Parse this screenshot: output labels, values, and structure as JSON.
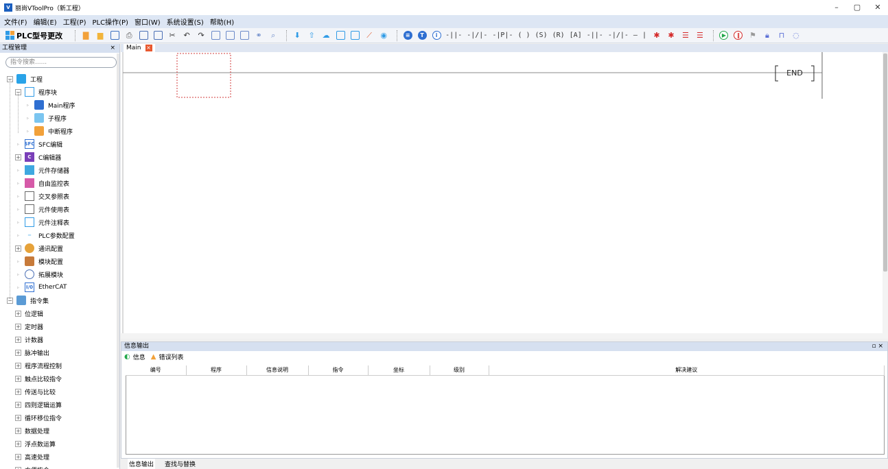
{
  "window": {
    "title": "丽尚VToolPro（新工程）",
    "controls": [
      "–",
      "▢",
      "✕"
    ]
  },
  "menu": [
    "文件(F)",
    "编辑(E)",
    "工程(P)",
    "PLC操作(P)",
    "窗口(W)",
    "系统设置(S)",
    "帮助(H)"
  ],
  "toolbar": {
    "plc_model_label": "PLC型号更改"
  },
  "project_panel": {
    "title": "工程管理",
    "close": "×",
    "search_placeholder": "指令搜索......",
    "tree": [
      {
        "label": "工程",
        "level": 0,
        "exp": "⊟",
        "icon": "folder-icon"
      },
      {
        "label": "程序块",
        "level": 1,
        "exp": "⊟",
        "icon": "program-block-icon"
      },
      {
        "label": "Main程序",
        "level": 2,
        "exp": "▹",
        "icon": "main-program-icon"
      },
      {
        "label": "子程序",
        "level": 2,
        "exp": "▹",
        "icon": "sub-program-icon"
      },
      {
        "label": "中断程序",
        "level": 2,
        "exp": "▹",
        "icon": "interrupt-program-icon"
      },
      {
        "label": "SFC编辑",
        "level": 1,
        "exp": "▹",
        "icon": "sfc-icon"
      },
      {
        "label": "C编辑器",
        "level": 1,
        "exp": "⊞",
        "icon": "c-editor-icon"
      },
      {
        "label": "元件存储器",
        "level": 1,
        "exp": "▹",
        "icon": "memory-icon"
      },
      {
        "label": "自由监控表",
        "level": 1,
        "exp": "▹",
        "icon": "monitor-icon"
      },
      {
        "label": "交叉参照表",
        "level": 1,
        "exp": "▹",
        "icon": "cross-ref-icon"
      },
      {
        "label": "元件使用表",
        "level": 1,
        "exp": "▹",
        "icon": "usage-table-icon"
      },
      {
        "label": "元件注释表",
        "level": 1,
        "exp": "▹",
        "icon": "comment-table-icon"
      },
      {
        "label": "PLC参数配置",
        "level": 1,
        "exp": "▹",
        "icon": "plc-params-icon"
      },
      {
        "label": "通讯配置",
        "level": 1,
        "exp": "⊞",
        "icon": "comm-config-icon"
      },
      {
        "label": "模块配置",
        "level": 1,
        "exp": "▹",
        "icon": "module-config-icon"
      },
      {
        "label": "拓展模块",
        "level": 1,
        "exp": "▹",
        "icon": "expansion-module-icon"
      },
      {
        "label": "EtherCAT",
        "level": 1,
        "exp": "▹",
        "icon": "ethercat-icon"
      },
      {
        "label": "指令集",
        "level": 0,
        "exp": "⊟",
        "icon": "instruction-set-icon"
      },
      {
        "label": "位逻辑",
        "level": 1,
        "exp": "⊞",
        "icon": ""
      },
      {
        "label": "定时器",
        "level": 1,
        "exp": "⊞",
        "icon": ""
      },
      {
        "label": "计数器",
        "level": 1,
        "exp": "⊞",
        "icon": ""
      },
      {
        "label": "脉冲输出",
        "level": 1,
        "exp": "⊞",
        "icon": ""
      },
      {
        "label": "程序流程控制",
        "level": 1,
        "exp": "⊞",
        "icon": ""
      },
      {
        "label": "触点比较指令",
        "level": 1,
        "exp": "⊞",
        "icon": ""
      },
      {
        "label": "传送与比较",
        "level": 1,
        "exp": "⊞",
        "icon": ""
      },
      {
        "label": "四则逻辑运算",
        "level": 1,
        "exp": "⊞",
        "icon": ""
      },
      {
        "label": "循环移位指令",
        "level": 1,
        "exp": "⊞",
        "icon": ""
      },
      {
        "label": "数据处理",
        "level": 1,
        "exp": "⊞",
        "icon": ""
      },
      {
        "label": "浮点数运算",
        "level": 1,
        "exp": "⊞",
        "icon": ""
      },
      {
        "label": "高速处理",
        "level": 1,
        "exp": "⊞",
        "icon": ""
      },
      {
        "label": "方便指令",
        "level": 1,
        "exp": "⊞",
        "icon": ""
      }
    ]
  },
  "editor": {
    "tab_label": "Main",
    "end_label": "END"
  },
  "info_panel": {
    "title": "信息输出",
    "subtab_info": "信息",
    "subtab_errors": "错误列表",
    "columns": [
      "编号",
      "程序",
      "信息说明",
      "指令",
      "坐标",
      "级别",
      "解决建议"
    ]
  },
  "bottom_tabs": [
    "信息输出",
    "查找与替换"
  ],
  "colors": {
    "menubar": "#dde6f4",
    "panel_header": "#d6e0f0",
    "accent_blue": "#2f9be6",
    "close_tab": "#e8582f"
  }
}
